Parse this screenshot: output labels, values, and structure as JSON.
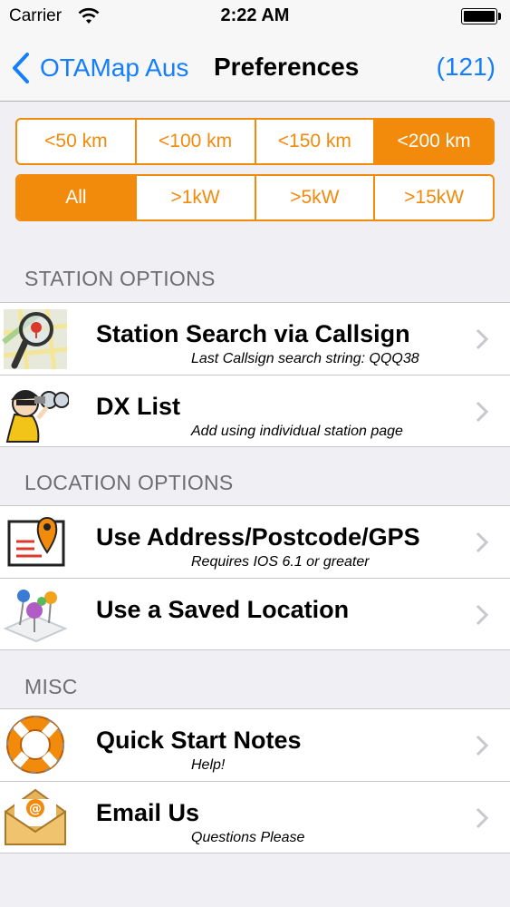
{
  "status_bar": {
    "carrier": "Carrier",
    "time": "2:22 AM"
  },
  "nav": {
    "back_label": "OTAMap Aus",
    "title": "Preferences",
    "count": "(121)"
  },
  "distance_filter": {
    "options": [
      "<50 km",
      "<100 km",
      "<150 km",
      "<200 km"
    ],
    "selected": "<200 km"
  },
  "power_filter": {
    "options": [
      "All",
      ">1kW",
      ">5kW",
      ">15kW"
    ],
    "selected": "All"
  },
  "sections": {
    "station": {
      "header": "STATION OPTIONS",
      "rows": [
        {
          "title": "Station Search via Callsign",
          "subtitle": "Last Callsign search string: QQQ38",
          "icon": "map-magnifier-icon"
        },
        {
          "title": "DX List",
          "subtitle": "Add using individual station page",
          "icon": "binoculars-spy-icon"
        }
      ]
    },
    "location": {
      "header": "LOCATION OPTIONS",
      "rows": [
        {
          "title": "Use Address/Postcode/GPS",
          "subtitle": "Requires IOS 6.1 or greater",
          "icon": "address-pin-icon"
        },
        {
          "title": "Use a Saved Location",
          "subtitle": "",
          "icon": "saved-pins-icon"
        }
      ]
    },
    "misc": {
      "header": "MISC",
      "rows": [
        {
          "title": "Quick Start Notes",
          "subtitle": "Help!",
          "icon": "lifebuoy-icon"
        },
        {
          "title": "Email Us",
          "subtitle": "Questions Please",
          "icon": "envelope-icon"
        }
      ]
    }
  },
  "colors": {
    "accent_orange": "#f28a0b",
    "ios_blue": "#147efb",
    "background": "#efeff4"
  }
}
